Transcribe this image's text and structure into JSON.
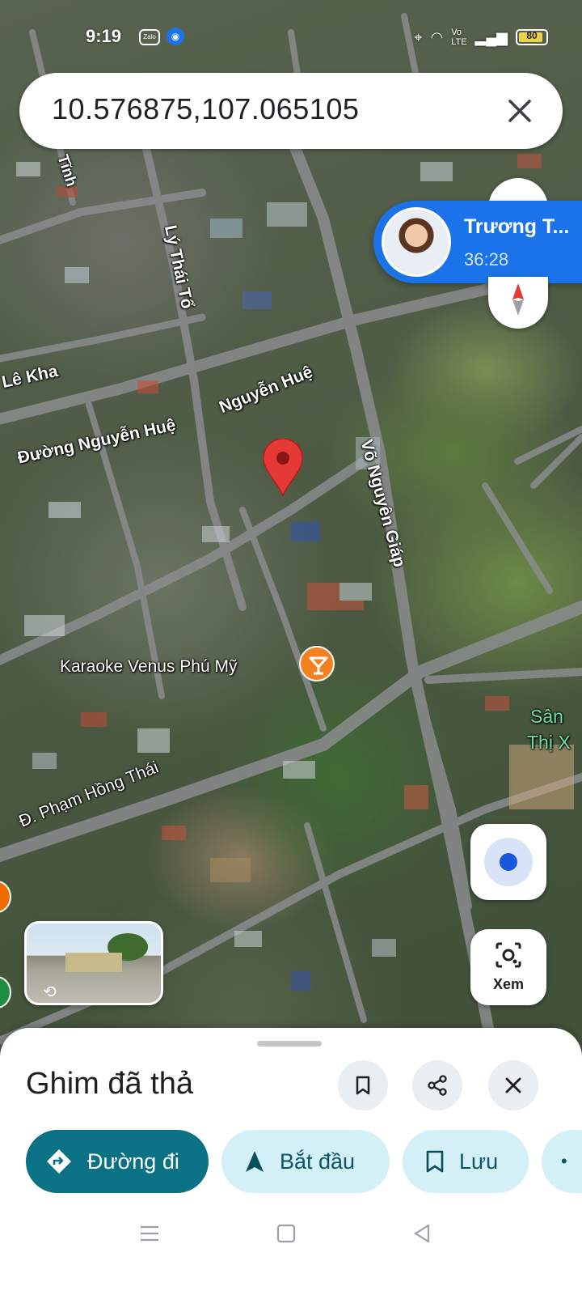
{
  "status_bar": {
    "time": "9:19",
    "zalo_label": "Zalo",
    "battery": "80"
  },
  "search": {
    "value": "10.576875,107.065105"
  },
  "chat_head": {
    "name": "Trương T...",
    "duration": "36:28"
  },
  "map_labels": {
    "ly_thai_to": "Lý Thái Tổ",
    "le_kha": "Lê Kha",
    "nguyen_hue_1": "Nguyễn Huệ",
    "nguyen_hue_2": "Đường Nguyễn Huệ",
    "vo_nguyen_giap": "Võ Nguyên Giáp",
    "karaoke": "Karaoke Venus Phú Mỹ",
    "pham_hong_thai": "Đ. Phạm Hồng Thái",
    "san": "Sân",
    "thi_x": "Thị X",
    "tinh": "Tĩnh"
  },
  "lens": {
    "label": "Xem"
  },
  "sheet": {
    "title": "Ghim đã thả",
    "chips": {
      "directions": "Đường đi",
      "start": "Bắt đầu",
      "save": "Lưu"
    }
  },
  "colors": {
    "primary": "#0b7285",
    "secondary_chip": "#d3f0f6",
    "pin": "#e53935",
    "chat_blue": "#1a73e8"
  },
  "icons": {
    "close": "close-icon",
    "bookmark": "bookmark-icon",
    "share": "share-icon",
    "directions": "directions-diamond-icon",
    "navigate": "navigation-arrow-icon",
    "lens": "camera-lens-icon",
    "location": "my-location-icon",
    "compass": "compass-icon",
    "pin": "map-pin-icon",
    "karaoke": "cocktail-icon"
  }
}
